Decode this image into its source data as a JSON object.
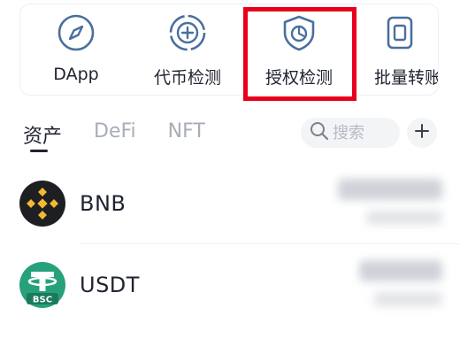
{
  "quick_actions": [
    {
      "label": "DApp",
      "icon": "compass-icon"
    },
    {
      "label": "代币检测",
      "icon": "token-check-icon"
    },
    {
      "label": "授权检测",
      "icon": "shield-check-icon"
    },
    {
      "label": "批量转账",
      "icon": "batch-transfer-icon"
    }
  ],
  "tabs": [
    {
      "label": "资产",
      "active": true
    },
    {
      "label": "DeFi",
      "active": false
    },
    {
      "label": "NFT",
      "active": false
    }
  ],
  "search": {
    "placeholder": "搜索"
  },
  "assets": [
    {
      "symbol": "BNB",
      "icon": "bnb-icon",
      "balance_visible": false
    },
    {
      "symbol": "USDT",
      "icon": "usdt-icon",
      "network_badge": "BSC",
      "balance_visible": false
    }
  ],
  "colors": {
    "highlight": "#e8001c",
    "icon_blue": "#4a6f9e",
    "bnb_yellow": "#f3ba2f",
    "usdt_green": "#26a17b"
  }
}
